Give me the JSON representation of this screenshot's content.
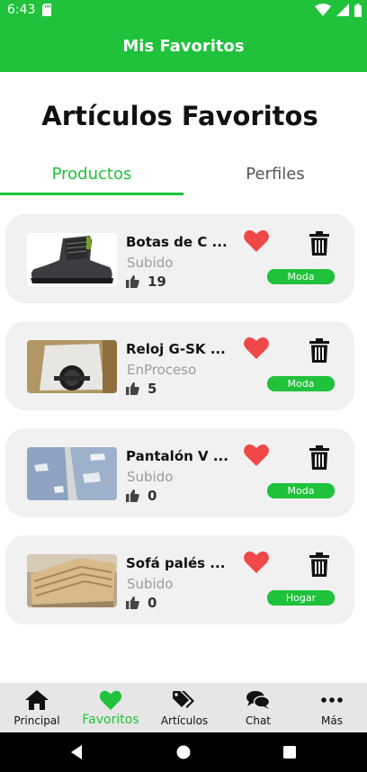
{
  "status_bar": {
    "time": "6:43",
    "icons": [
      "sd-card-icon",
      "wifi-icon",
      "signal-icon",
      "battery-icon"
    ]
  },
  "app_bar": {
    "title": "Mis Favoritos"
  },
  "page_heading": "Artículos Favoritos",
  "tabs": [
    {
      "label": "Productos",
      "active": true
    },
    {
      "label": "Perfiles",
      "active": false
    }
  ],
  "items": [
    {
      "name": "Botas de C ...",
      "status": "Subido",
      "likes": "19",
      "category": "Moda",
      "thumb": "boots-image",
      "favorite": true
    },
    {
      "name": "Reloj G-SK ...",
      "status": "EnProceso",
      "likes": "5",
      "category": "Moda",
      "thumb": "watch-image",
      "favorite": true
    },
    {
      "name": "Pantalón V ...",
      "status": "Subido",
      "likes": "0",
      "category": "Moda",
      "thumb": "jeans-image",
      "favorite": true
    },
    {
      "name": "Sofá palés ...",
      "status": "Subido",
      "likes": "0",
      "category": "Hogar",
      "thumb": "pallet-sofa-image",
      "favorite": true
    }
  ],
  "bottom_nav": [
    {
      "label": "Principal",
      "icon": "home-icon",
      "active": false
    },
    {
      "label": "Favoritos",
      "icon": "heart-icon",
      "active": true
    },
    {
      "label": "Artículos",
      "icon": "tags-icon",
      "active": false
    },
    {
      "label": "Chat",
      "icon": "chat-icon",
      "active": false
    },
    {
      "label": "Más",
      "icon": "more-icon",
      "active": false
    }
  ],
  "colors": {
    "brand_green": "#1fc23a",
    "heart_red": "#f04848",
    "card_bg": "#f1f1f1",
    "muted_text": "#9a9aa3",
    "nav_bg": "#e6e6e6"
  }
}
